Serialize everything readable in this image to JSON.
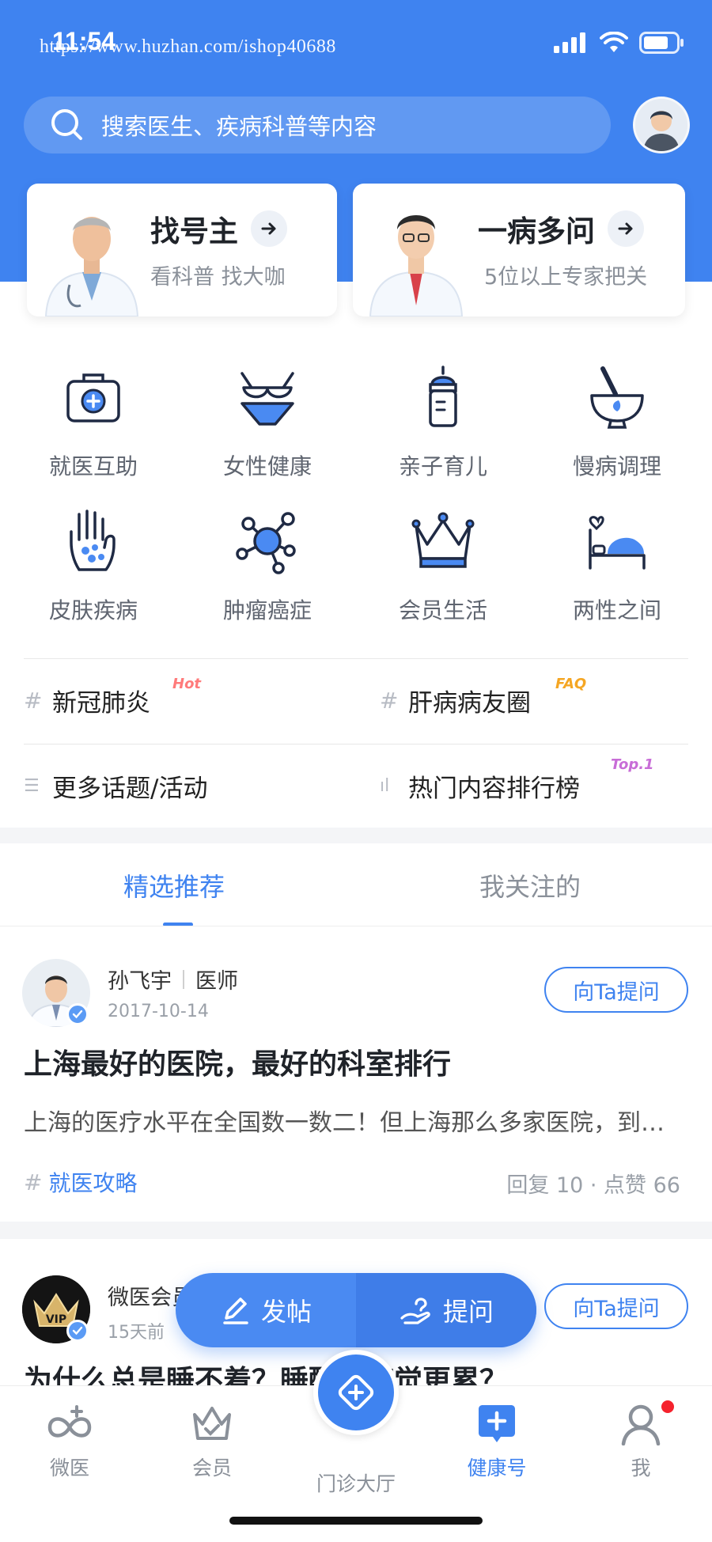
{
  "status_bar": {
    "time": "11:54",
    "watermark": "https://www.huzhan.com/ishop40688"
  },
  "search": {
    "placeholder": "搜索医生、疾病科普等内容"
  },
  "promo": [
    {
      "title": "找号主",
      "subtitle": "看科普 找大咖"
    },
    {
      "title": "一病多问",
      "subtitle": "5位以上专家把关"
    }
  ],
  "categories": [
    {
      "label": "就医互助",
      "icon": "medical-kit-icon"
    },
    {
      "label": "女性健康",
      "icon": "bra-icon"
    },
    {
      "label": "亲子育儿",
      "icon": "baby-bottle-icon"
    },
    {
      "label": "慢病调理",
      "icon": "mortar-icon"
    },
    {
      "label": "皮肤疾病",
      "icon": "hand-icon"
    },
    {
      "label": "肿瘤癌症",
      "icon": "molecule-icon"
    },
    {
      "label": "会员生活",
      "icon": "crown-icon"
    },
    {
      "label": "两性之间",
      "icon": "bed-heart-icon"
    }
  ],
  "topics": [
    {
      "label": "新冠肺炎",
      "mark": "#",
      "tag": "Hot",
      "tag_color": "#ff7a7a"
    },
    {
      "label": "肝病病友圈",
      "mark": "#",
      "tag": "FAQ",
      "tag_color": "#f5a623"
    },
    {
      "label": "更多话题/活动",
      "mark": "☰",
      "tag": "",
      "tag_color": ""
    },
    {
      "label": "热门内容排行榜",
      "mark": "ıl",
      "tag": "Top.1",
      "tag_color": "#c86dd7"
    }
  ],
  "tabs": [
    {
      "label": "精选推荐",
      "active": true
    },
    {
      "label": "我关注的",
      "active": false
    }
  ],
  "posts": [
    {
      "author": "孙飞宇",
      "role": "医师",
      "date": "2017-10-14",
      "ask_label": "向Ta提问",
      "title": "上海最好的医院，最好的科室排行",
      "excerpt": "上海的医疗水平在全国数一数二！但上海那么多家医院，到底哪家好？",
      "tag": "就医攻略",
      "stats": "回复 10 · 点赞 66"
    },
    {
      "author": "微医会员",
      "date": "15天前",
      "ask_label": "向Ta提问",
      "title": "为什么总是睡不着？睡醒还感觉更累？"
    }
  ],
  "fab": {
    "post_label": "发帖",
    "ask_label": "提问"
  },
  "bottom_nav": [
    {
      "label": "微医",
      "icon": "weiyi-logo-icon",
      "active": false
    },
    {
      "label": "会员",
      "icon": "member-crown-icon",
      "active": false
    },
    {
      "label": "门诊大厅",
      "icon": "clinic-icon",
      "active": false
    },
    {
      "label": "健康号",
      "icon": "health-plus-icon",
      "active": true
    },
    {
      "label": "我",
      "icon": "user-icon",
      "active": false
    }
  ],
  "colors": {
    "brand": "#3f83f0",
    "text": "#1f2329",
    "muted": "#8a9099"
  }
}
